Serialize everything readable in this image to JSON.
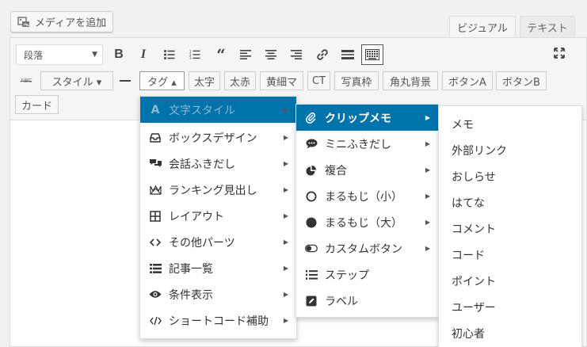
{
  "media_button": {
    "label": "メディアを追加"
  },
  "tabs": {
    "visual": "ビジュアル",
    "text": "テキスト"
  },
  "toolbar": {
    "format_select": "段落",
    "row2_buttons": [
      "スタイル ▾",
      "タグ ▴",
      "太字",
      "太赤",
      "黄細マ",
      "CT",
      "写真枠",
      "角丸背景",
      "ボタンA",
      "ボタンB",
      "カード"
    ]
  },
  "menu1": {
    "items": [
      {
        "label": "文字スタイル",
        "icon": "text-icon",
        "arrow": true
      },
      {
        "label": "ボックスデザイン",
        "icon": "inbox-icon",
        "arrow": true
      },
      {
        "label": "会話ふきだし",
        "icon": "comments-icon",
        "arrow": true
      },
      {
        "label": "ランキング見出し",
        "icon": "crown-icon",
        "arrow": true
      },
      {
        "label": "レイアウト",
        "icon": "grid-icon",
        "arrow": true
      },
      {
        "label": "その他パーツ",
        "icon": "code-icon",
        "arrow": true
      },
      {
        "label": "記事一覧",
        "icon": "list-icon",
        "arrow": true
      },
      {
        "label": "条件表示",
        "icon": "eye-icon",
        "arrow": true
      },
      {
        "label": "ショートコード補助",
        "icon": "code-slash-icon",
        "arrow": true
      }
    ]
  },
  "menu2": {
    "items": [
      {
        "label": "クリップメモ",
        "icon": "paperclip-icon",
        "arrow": true
      },
      {
        "label": "ミニふきだし",
        "icon": "comment-dots-icon",
        "arrow": true
      },
      {
        "label": "複合",
        "icon": "pie-icon",
        "arrow": true
      },
      {
        "label": "まるもじ（小）",
        "icon": "circle-outline-icon",
        "arrow": true
      },
      {
        "label": "まるもじ（大）",
        "icon": "circle-filled-icon",
        "arrow": true
      },
      {
        "label": "カスタムボタン",
        "icon": "toggle-icon",
        "arrow": true
      },
      {
        "label": "ステップ",
        "icon": "numbered-list-icon",
        "arrow": false
      },
      {
        "label": "ラベル",
        "icon": "edit-icon",
        "arrow": false
      }
    ]
  },
  "menu3": {
    "items": [
      "メモ",
      "外部リンク",
      "おしらせ",
      "はてな",
      "コメント",
      "コード",
      "ポイント",
      "ユーザー",
      "初心者"
    ]
  },
  "colors": {
    "accent": "#0073aa",
    "toolbar_bg": "#f5f5f5",
    "border": "#dddddd"
  }
}
